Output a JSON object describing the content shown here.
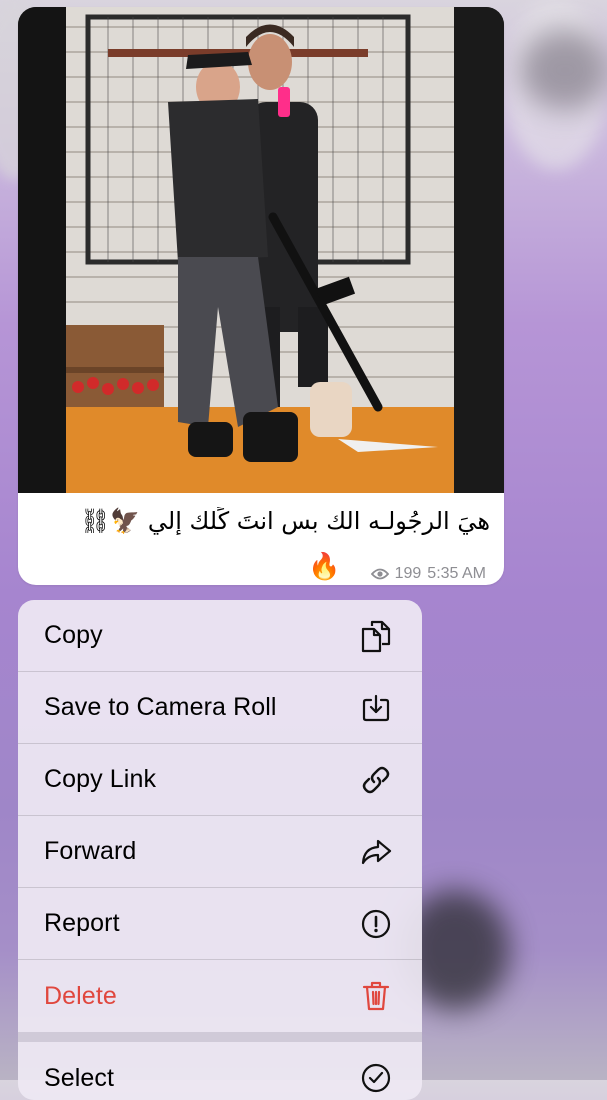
{
  "message": {
    "caption": "هيَ الرجُولـه الك بس انتَ كًلك إلي 🦅⛓",
    "reaction": "🔥",
    "views": "199",
    "time": "5:35 AM"
  },
  "menu": {
    "items": [
      {
        "label": "Copy",
        "icon": "copy-icon"
      },
      {
        "label": "Save to Camera Roll",
        "icon": "download-icon"
      },
      {
        "label": "Copy Link",
        "icon": "link-icon"
      },
      {
        "label": "Forward",
        "icon": "forward-icon"
      },
      {
        "label": "Report",
        "icon": "exclamation-circle-icon"
      },
      {
        "label": "Delete",
        "icon": "trash-icon"
      },
      {
        "label": "Select",
        "icon": "check-circle-icon"
      }
    ]
  },
  "colors": {
    "danger": "#e0473e",
    "meta_gray": "#8e8e93",
    "menu_bg": "#eee8f3"
  }
}
